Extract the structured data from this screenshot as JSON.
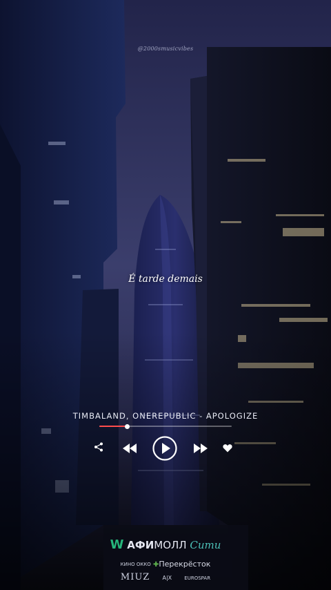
{
  "watermark": "@2000smusicvibes",
  "lyric": "É tarde demais",
  "player": {
    "track_title": "TIMBALAND, ONEREPUBLIC - APOLOGIZE",
    "progress": 0.21,
    "accent_color": "#ff4d4d",
    "controls": {
      "share_icon": "share-icon",
      "rewind_icon": "rewind-icon",
      "play_icon": "play-icon",
      "forward_icon": "fast-forward-icon",
      "like_icon": "heart-icon"
    }
  },
  "logos": {
    "w": "W",
    "afi": "АФИ",
    "mall": "МОЛЛ",
    "city": "Сити",
    "kino": "КИНО ОККО",
    "perekrestok": "Перекрёсток",
    "miuz": "MIUZ",
    "ax": "A|X",
    "eurospar": "EUROSPAR"
  }
}
